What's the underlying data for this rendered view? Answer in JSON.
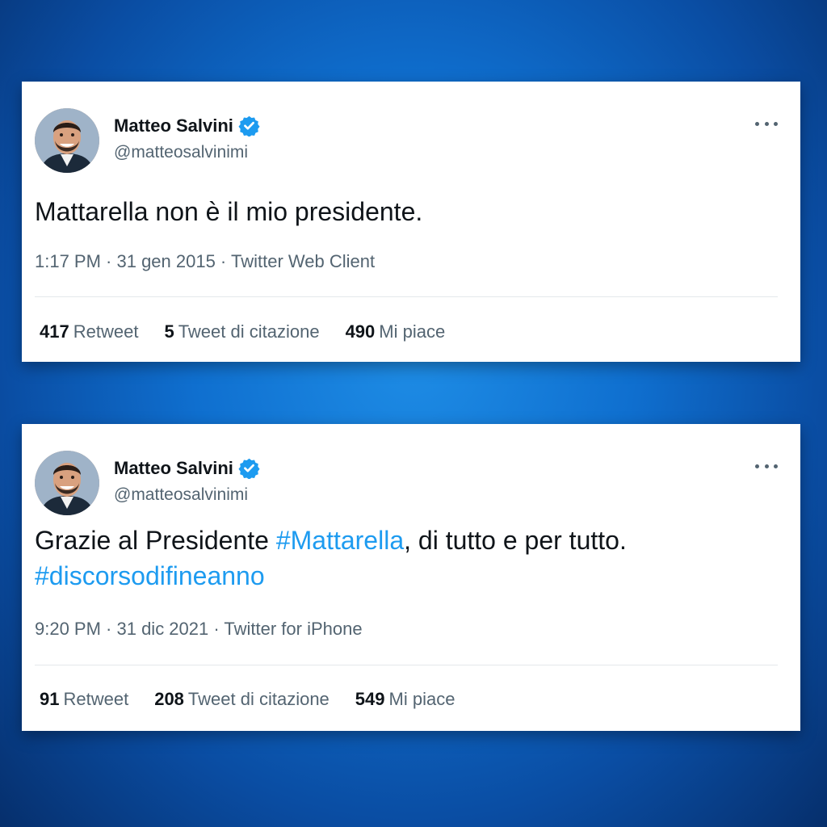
{
  "tweets": [
    {
      "author_name": "Matteo Salvini",
      "author_handle": "@matteosalvinimi",
      "verified": true,
      "text_segments": [
        {
          "text": "Mattarella non è il mio presidente.",
          "type": "text"
        }
      ],
      "meta": "1:17 PM · 31 gen 2015 · Twitter Web Client",
      "stats": [
        {
          "count": "417",
          "label": "Retweet"
        },
        {
          "count": "5",
          "label": "Tweet di citazione"
        },
        {
          "count": "490",
          "label": "Mi piace"
        }
      ]
    },
    {
      "author_name": "Matteo Salvini",
      "author_handle": "@matteosalvinimi",
      "verified": true,
      "text_segments": [
        {
          "text": "Grazie al Presidente ",
          "type": "text"
        },
        {
          "text": "#Mattarella",
          "type": "hashtag"
        },
        {
          "text": ", di tutto e per tutto. ",
          "type": "text"
        },
        {
          "text": "#discorsodifineanno",
          "type": "hashtag"
        }
      ],
      "meta": "9:20 PM · 31 dic 2021 · Twitter for iPhone",
      "stats": [
        {
          "count": "91",
          "label": "Retweet"
        },
        {
          "count": "208",
          "label": "Tweet di citazione"
        },
        {
          "count": "549",
          "label": "Mi piace"
        }
      ]
    }
  ],
  "colors": {
    "hashtag": "#1d9bf0",
    "verified_badge": "#1d9bf0",
    "secondary_text": "#536471",
    "primary_text": "#0f1419",
    "background": "#0f6fcf"
  },
  "icons": {
    "verified": "verified-badge-icon",
    "more": "more-options-icon"
  }
}
